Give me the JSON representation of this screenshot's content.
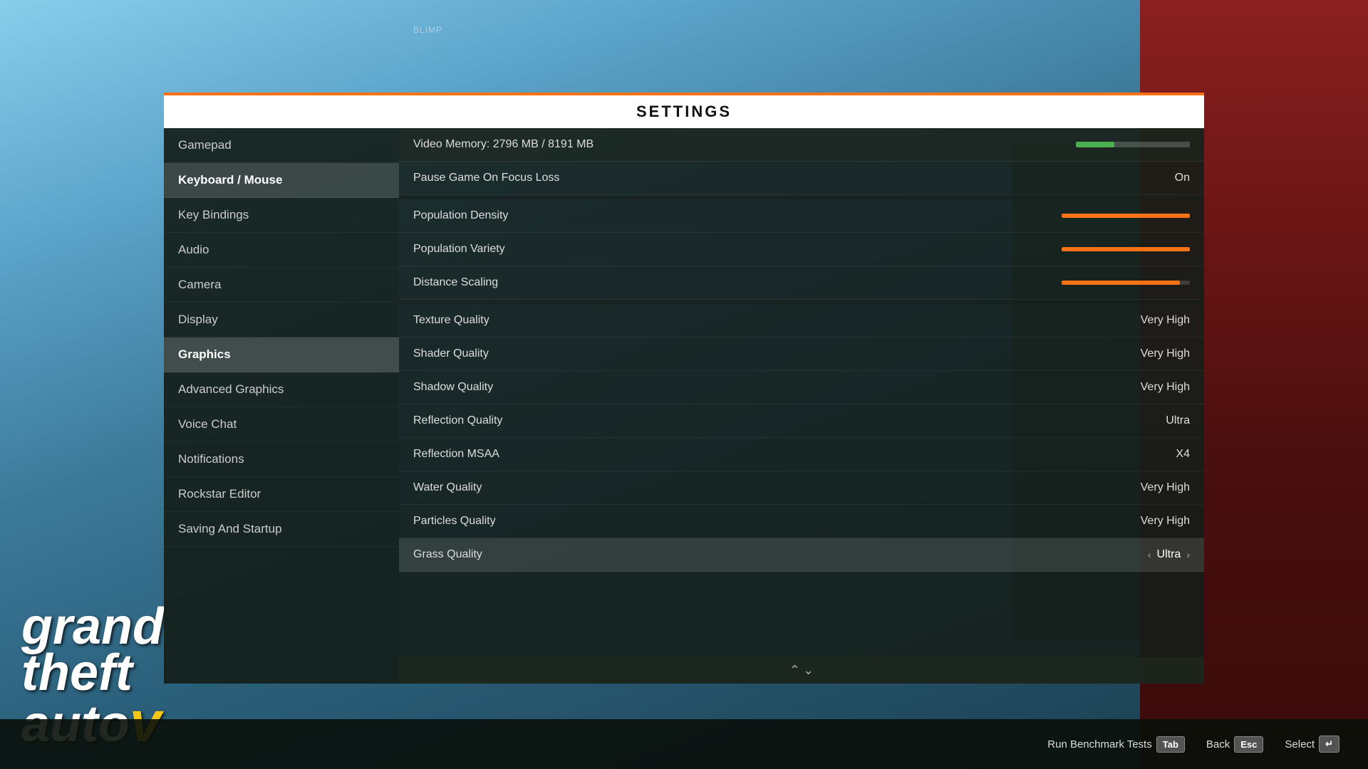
{
  "background": {
    "blimp_text": "BLIMP"
  },
  "title_bar": {
    "title": "SETTINGS"
  },
  "nav": {
    "items": [
      {
        "id": "gamepad",
        "label": "Gamepad",
        "active": false
      },
      {
        "id": "keyboard-mouse",
        "label": "Keyboard / Mouse",
        "active": false
      },
      {
        "id": "key-bindings",
        "label": "Key Bindings",
        "active": false
      },
      {
        "id": "audio",
        "label": "Audio",
        "active": false
      },
      {
        "id": "camera",
        "label": "Camera",
        "active": false
      },
      {
        "id": "display",
        "label": "Display",
        "active": false
      },
      {
        "id": "graphics",
        "label": "Graphics",
        "active": true
      },
      {
        "id": "advanced-graphics",
        "label": "Advanced Graphics",
        "active": false
      },
      {
        "id": "voice-chat",
        "label": "Voice Chat",
        "active": false
      },
      {
        "id": "notifications",
        "label": "Notifications",
        "active": false
      },
      {
        "id": "rockstar-editor",
        "label": "Rockstar Editor",
        "active": false
      },
      {
        "id": "saving-startup",
        "label": "Saving And Startup",
        "active": false
      }
    ]
  },
  "main": {
    "video_memory": {
      "label": "Video Memory: 2796 MB / 8191 MB",
      "fill_percent": 34
    },
    "settings": [
      {
        "id": "pause-game",
        "label": "Pause Game On Focus Loss",
        "value": "On",
        "type": "value"
      },
      {
        "id": "population-density",
        "label": "Population Density",
        "value": null,
        "type": "slider",
        "fill": 100
      },
      {
        "id": "population-variety",
        "label": "Population Variety",
        "value": null,
        "type": "slider",
        "fill": 100
      },
      {
        "id": "distance-scaling",
        "label": "Distance Scaling",
        "value": null,
        "type": "slider",
        "fill": 92
      },
      {
        "id": "texture-quality",
        "label": "Texture Quality",
        "value": "Very High",
        "type": "value"
      },
      {
        "id": "shader-quality",
        "label": "Shader Quality",
        "value": "Very High",
        "type": "value"
      },
      {
        "id": "shadow-quality",
        "label": "Shadow Quality",
        "value": "Very High",
        "type": "value"
      },
      {
        "id": "reflection-quality",
        "label": "Reflection Quality",
        "value": "Ultra",
        "type": "value"
      },
      {
        "id": "reflection-msaa",
        "label": "Reflection MSAA",
        "value": "X4",
        "type": "value"
      },
      {
        "id": "water-quality",
        "label": "Water Quality",
        "value": "Very High",
        "type": "value"
      },
      {
        "id": "particles-quality",
        "label": "Particles Quality",
        "value": "Very High",
        "type": "value"
      },
      {
        "id": "grass-quality",
        "label": "Grass Quality",
        "value": "Ultra",
        "type": "active_value",
        "arrow_left": "‹",
        "arrow_right": "›"
      }
    ]
  },
  "bottom_bar": {
    "benchmark": {
      "label": "Run Benchmark Tests",
      "key": "Tab"
    },
    "back": {
      "label": "Back",
      "key": "Esc"
    },
    "select": {
      "label": "Select",
      "key": "↵"
    }
  },
  "logo": {
    "line1": "grand",
    "line2": "theft",
    "line3": "auto",
    "five": "V"
  }
}
